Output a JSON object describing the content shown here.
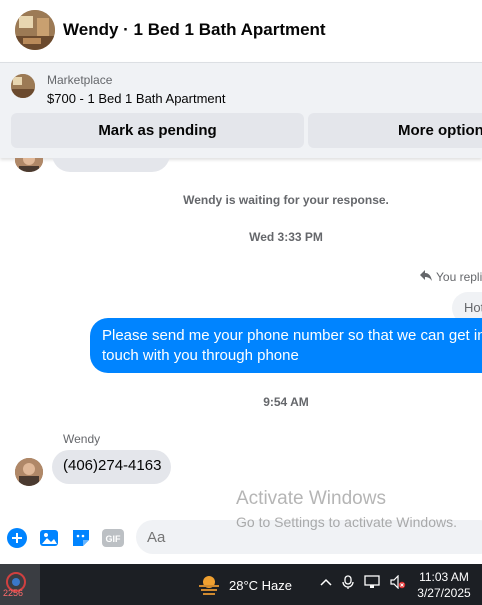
{
  "header": {
    "title": "Wendy · 1 Bed 1 Bath Apartment",
    "avatar_icon": "apartment-photo"
  },
  "marketplace": {
    "label": "Marketplace",
    "listing": "$700 - 1 Bed 1 Bath Apartment",
    "mark_pending_label": "Mark as pending",
    "more_options_label": "More options"
  },
  "messages": {
    "waiting_text": "Wendy is waiting for your response.",
    "timestamp_1": "Wed 3:33 PM",
    "replied_label": "You replied",
    "quoted_preview": "Hot",
    "outgoing_text": "Please send me your phone  number so that we can get in touch with you through phone",
    "timestamp_2": "9:54 AM",
    "sender_name": "Wendy",
    "incoming_text": "(406)274-4163"
  },
  "watermark": {
    "title": "Activate Windows",
    "subtitle": "Go to Settings to activate Windows."
  },
  "composer": {
    "placeholder": "Aa",
    "icons": [
      "plus-icon",
      "photo-icon",
      "sticker-icon",
      "gif-icon"
    ]
  },
  "taskbar": {
    "badge": "2256",
    "weather": "28°C  Haze",
    "time": "11:03 AM",
    "date": "3/27/2025"
  },
  "colors": {
    "accent": "#0084ff",
    "bubble_gray": "#e4e6eb",
    "panel_gray": "#f0f2f5"
  }
}
